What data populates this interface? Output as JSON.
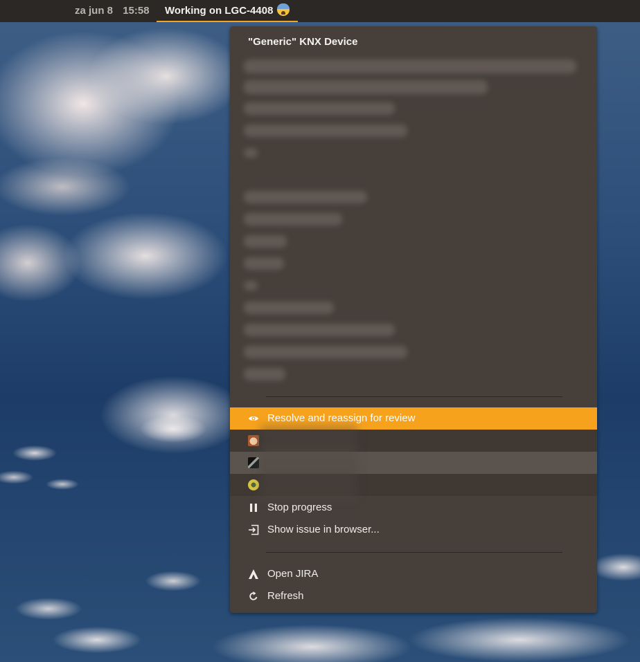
{
  "topbar": {
    "date": "za jun 8",
    "time": "15:58",
    "indicator_label": "Working on LGC-4408",
    "indicator_icon": "anxious-face-emoji-icon"
  },
  "menu": {
    "title": "\"Generic\" KNX Device",
    "actions": {
      "resolve_label": "Resolve and reassign for review",
      "resolve_icon": "eye-icon",
      "stop_label": "Stop progress",
      "stop_icon": "pause-icon",
      "show_label": "Show issue in browser...",
      "show_icon": "open-external-icon"
    },
    "reviewers": [
      {
        "avatar_color": "#c9835a"
      },
      {
        "avatar_color": "#1c1c1c"
      },
      {
        "avatar_color": "#c8b43a"
      }
    ],
    "footer": {
      "open_jira_label": "Open JIRA",
      "open_jira_icon": "jira-logo-icon",
      "refresh_label": "Refresh",
      "refresh_icon": "refresh-icon"
    }
  },
  "colors": {
    "accent": "#f6a21d",
    "menu_bg": "#473f3a",
    "topbar_bg": "#2b2825"
  }
}
